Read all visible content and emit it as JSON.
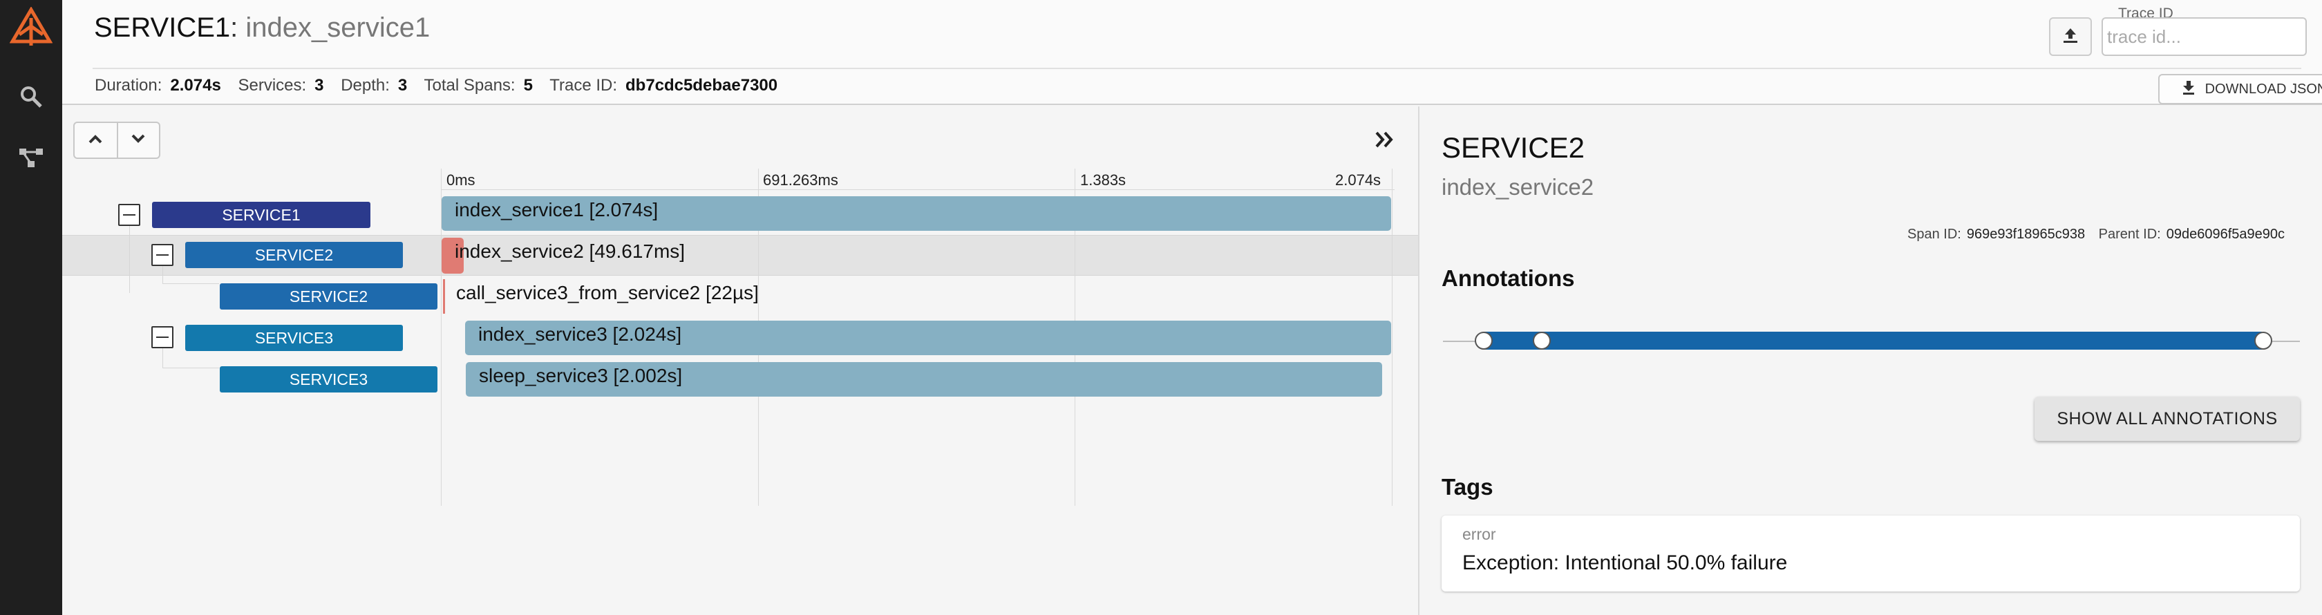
{
  "header": {
    "service": "SERVICE1",
    "separator": ":",
    "operation": "index_service1",
    "meta": [
      {
        "key": "Duration:",
        "value": "2.074s"
      },
      {
        "key": "Services:",
        "value": "3"
      },
      {
        "key": "Depth:",
        "value": "3"
      },
      {
        "key": "Total Spans:",
        "value": "5"
      },
      {
        "key": "Trace ID:",
        "value": "db7cdc5debae7300"
      }
    ],
    "trace_id_label": "Trace ID",
    "trace_id_placeholder": "trace id...",
    "download_label": "DOWNLOAD JSON"
  },
  "timeline": {
    "ticks": [
      "0ms",
      "691.263ms",
      "1.383s",
      "2.074s"
    ],
    "spans": [
      {
        "service": "SERVICE1",
        "label": "index_service1 [2.074s]",
        "color": "#2b3a8c"
      },
      {
        "service": "SERVICE2",
        "label": "index_service2 [49.617ms]",
        "color": "#1e6aad"
      },
      {
        "service": "SERVICE2",
        "label": "call_service3_from_service2 [22µs]",
        "color": "#1e6aad"
      },
      {
        "service": "SERVICE3",
        "label": "index_service3 [2.024s]",
        "color": "#1379ad"
      },
      {
        "service": "SERVICE3",
        "label": "sleep_service3 [2.002s]",
        "color": "#1379ad"
      }
    ],
    "bar_color": "#86b0c3",
    "error_color": "#e07b73"
  },
  "detail": {
    "service": "SERVICE2",
    "operation": "index_service2",
    "span_id_label": "Span ID:",
    "span_id": "969e93f18965c938",
    "parent_id_label": "Parent ID:",
    "parent_id": "09de6096f5a9e90c",
    "annotations_heading": "Annotations",
    "show_all_label": "SHOW ALL ANNOTATIONS",
    "tags_heading": "Tags",
    "tags": [
      {
        "key": "error",
        "value": "Exception: Intentional 50.0% failure"
      }
    ]
  },
  "colors": {
    "accent": "#e8672c",
    "annotation_bar": "#1565a8"
  },
  "icons": [
    "zipkin-logo-icon",
    "search-icon",
    "dependencies-icon",
    "upload-icon",
    "download-icon",
    "chevron-up-icon",
    "chevron-down-icon",
    "double-chevron-right-icon"
  ]
}
